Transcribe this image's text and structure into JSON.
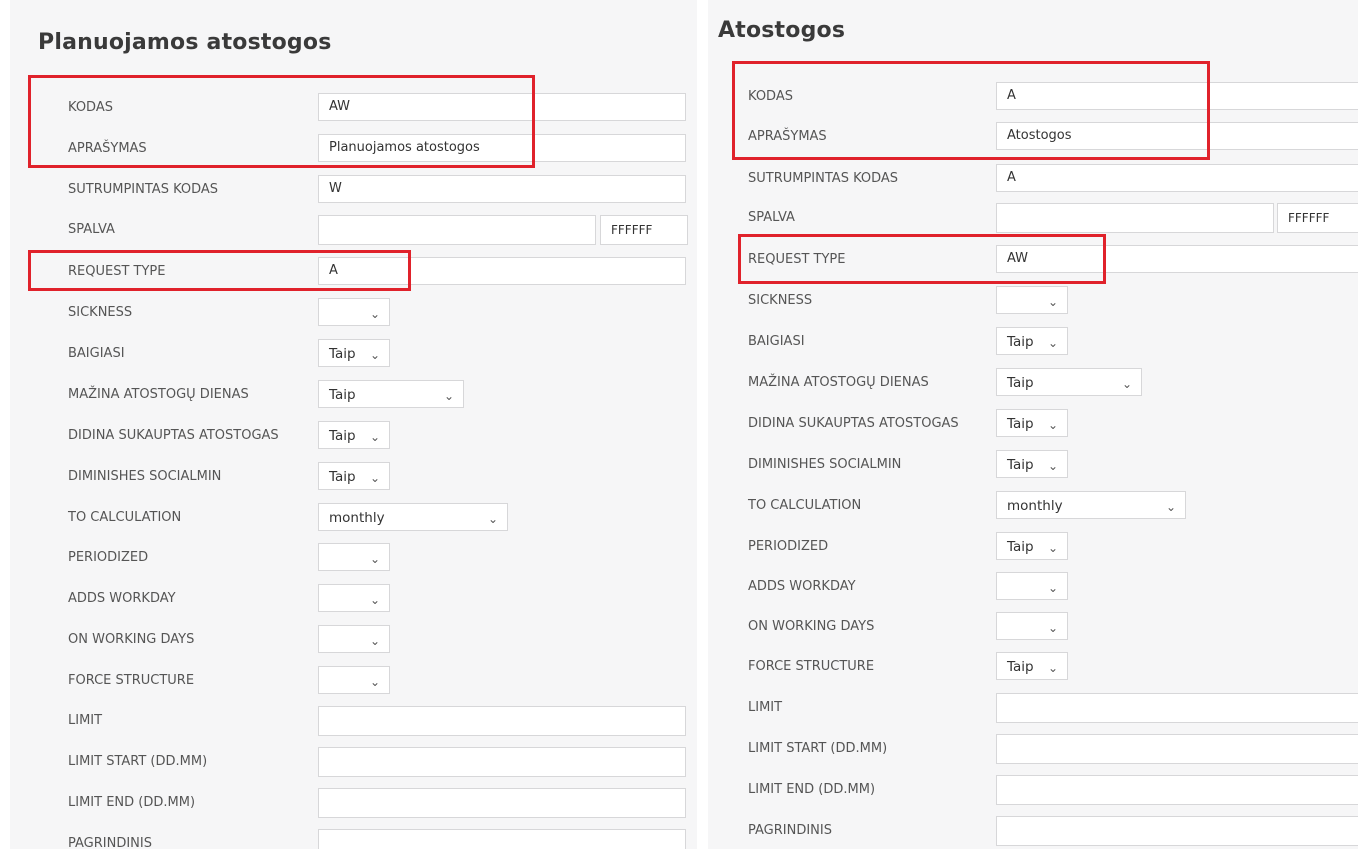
{
  "left": {
    "title": "Planuojamos atostogos",
    "fields": {
      "kodas": {
        "label": "KODAS",
        "value": "AW"
      },
      "aprasymas": {
        "label": "APRAŠYMAS",
        "value": "Planuojamos atostogos"
      },
      "sutrumpintas": {
        "label": "SUTRUMPINTAS KODAS",
        "value": "W"
      },
      "spalva": {
        "label": "SPALVA",
        "value": "",
        "hex": "FFFFFF"
      },
      "request_type": {
        "label": "REQUEST TYPE",
        "value": "A"
      },
      "sickness": {
        "label": "SICKNESS",
        "value": ""
      },
      "baigiasi": {
        "label": "BAIGIASI",
        "value": "Taip"
      },
      "mazina": {
        "label": "MAŽINA ATOSTOGŲ DIENAS",
        "value": "Taip"
      },
      "didina": {
        "label": "DIDINA SUKAUPTAS ATOSTOGAS",
        "value": "Taip"
      },
      "diminishes": {
        "label": "DIMINISHES SOCIALMIN",
        "value": "Taip"
      },
      "to_calculation": {
        "label": "TO CALCULATION",
        "value": "monthly"
      },
      "periodized": {
        "label": "PERIODIZED",
        "value": ""
      },
      "adds_workday": {
        "label": "ADDS WORKDAY",
        "value": ""
      },
      "on_working_days": {
        "label": "ON WORKING DAYS",
        "value": ""
      },
      "force_structure": {
        "label": "FORCE STRUCTURE",
        "value": ""
      },
      "limit": {
        "label": "LIMIT",
        "value": ""
      },
      "limit_start": {
        "label": "LIMIT START (DD.MM)",
        "value": ""
      },
      "limit_end": {
        "label": "LIMIT END (DD.MM)",
        "value": ""
      },
      "pagrindinis": {
        "label": "PAGRINDINIS",
        "value": ""
      }
    }
  },
  "right": {
    "title": "Atostogos",
    "fields": {
      "kodas": {
        "label": "KODAS",
        "value": "A"
      },
      "aprasymas": {
        "label": "APRAŠYMAS",
        "value": "Atostogos"
      },
      "sutrumpintas": {
        "label": "SUTRUMPINTAS KODAS",
        "value": "A"
      },
      "spalva": {
        "label": "SPALVA",
        "value": "",
        "hex": "FFFFFF"
      },
      "request_type": {
        "label": "REQUEST TYPE",
        "value": "AW"
      },
      "sickness": {
        "label": "SICKNESS",
        "value": ""
      },
      "baigiasi": {
        "label": "BAIGIASI",
        "value": "Taip"
      },
      "mazina": {
        "label": "MAŽINA ATOSTOGŲ DIENAS",
        "value": "Taip"
      },
      "didina": {
        "label": "DIDINA SUKAUPTAS ATOSTOGAS",
        "value": "Taip"
      },
      "diminishes": {
        "label": "DIMINISHES SOCIALMIN",
        "value": "Taip"
      },
      "to_calculation": {
        "label": "TO CALCULATION",
        "value": "monthly"
      },
      "periodized": {
        "label": "PERIODIZED",
        "value": "Taip"
      },
      "adds_workday": {
        "label": "ADDS WORKDAY",
        "value": ""
      },
      "on_working_days": {
        "label": "ON WORKING DAYS",
        "value": ""
      },
      "force_structure": {
        "label": "FORCE STRUCTURE",
        "value": "Taip"
      },
      "limit": {
        "label": "LIMIT",
        "value": ""
      },
      "limit_start": {
        "label": "LIMIT START (DD.MM)",
        "value": ""
      },
      "limit_end": {
        "label": "LIMIT END (DD.MM)",
        "value": ""
      },
      "pagrindinis": {
        "label": "PAGRINDINIS",
        "value": ""
      }
    }
  },
  "icons": {
    "dropdown": "chevron-down-icon"
  },
  "colors": {
    "highlight": "#e0222b"
  }
}
